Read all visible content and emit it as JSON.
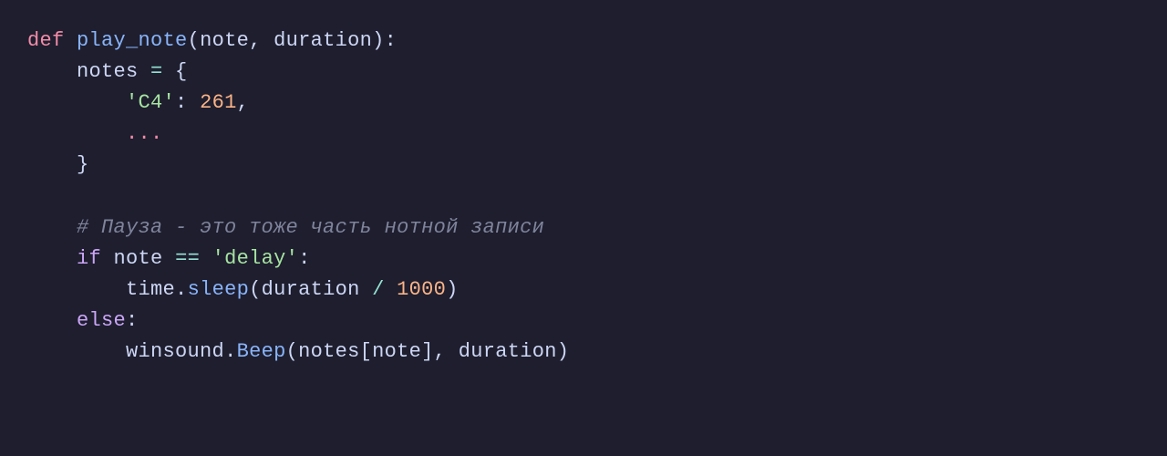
{
  "code": {
    "line1": {
      "def": "def",
      "fnName": "play_note",
      "lparen": "(",
      "param1": "note",
      "comma": ", ",
      "param2": "duration",
      "rparen": ")",
      "colon": ":"
    },
    "line2": {
      "indent": "    ",
      "var": "notes",
      "eq": " = ",
      "brace": "{"
    },
    "line3": {
      "indent": "        ",
      "key": "'C4'",
      "colon": ": ",
      "value": "261",
      "comma": ","
    },
    "line4": {
      "indent": "        ",
      "ellipsis": "..."
    },
    "line5": {
      "indent": "    ",
      "brace": "}"
    },
    "line6": "",
    "line7": {
      "indent": "    ",
      "comment": "# Пауза - это тоже часть нотной записи"
    },
    "line8": {
      "indent": "    ",
      "if": "if",
      "sp": " ",
      "var": "note",
      "eq": " == ",
      "string": "'delay'",
      "colon": ":"
    },
    "line9": {
      "indent": "        ",
      "module": "time",
      "dot": ".",
      "fn": "sleep",
      "lparen": "(",
      "arg": "duration",
      "div": " / ",
      "num": "1000",
      "rparen": ")"
    },
    "line10": {
      "indent": "    ",
      "else": "else",
      "colon": ":"
    },
    "line11": {
      "indent": "        ",
      "module": "winsound",
      "dot": ".",
      "fn": "Beep",
      "lparen": "(",
      "dict": "notes",
      "lbracket": "[",
      "key": "note",
      "rbracket": "]",
      "comma": ", ",
      "arg": "duration",
      "rparen": ")"
    }
  }
}
